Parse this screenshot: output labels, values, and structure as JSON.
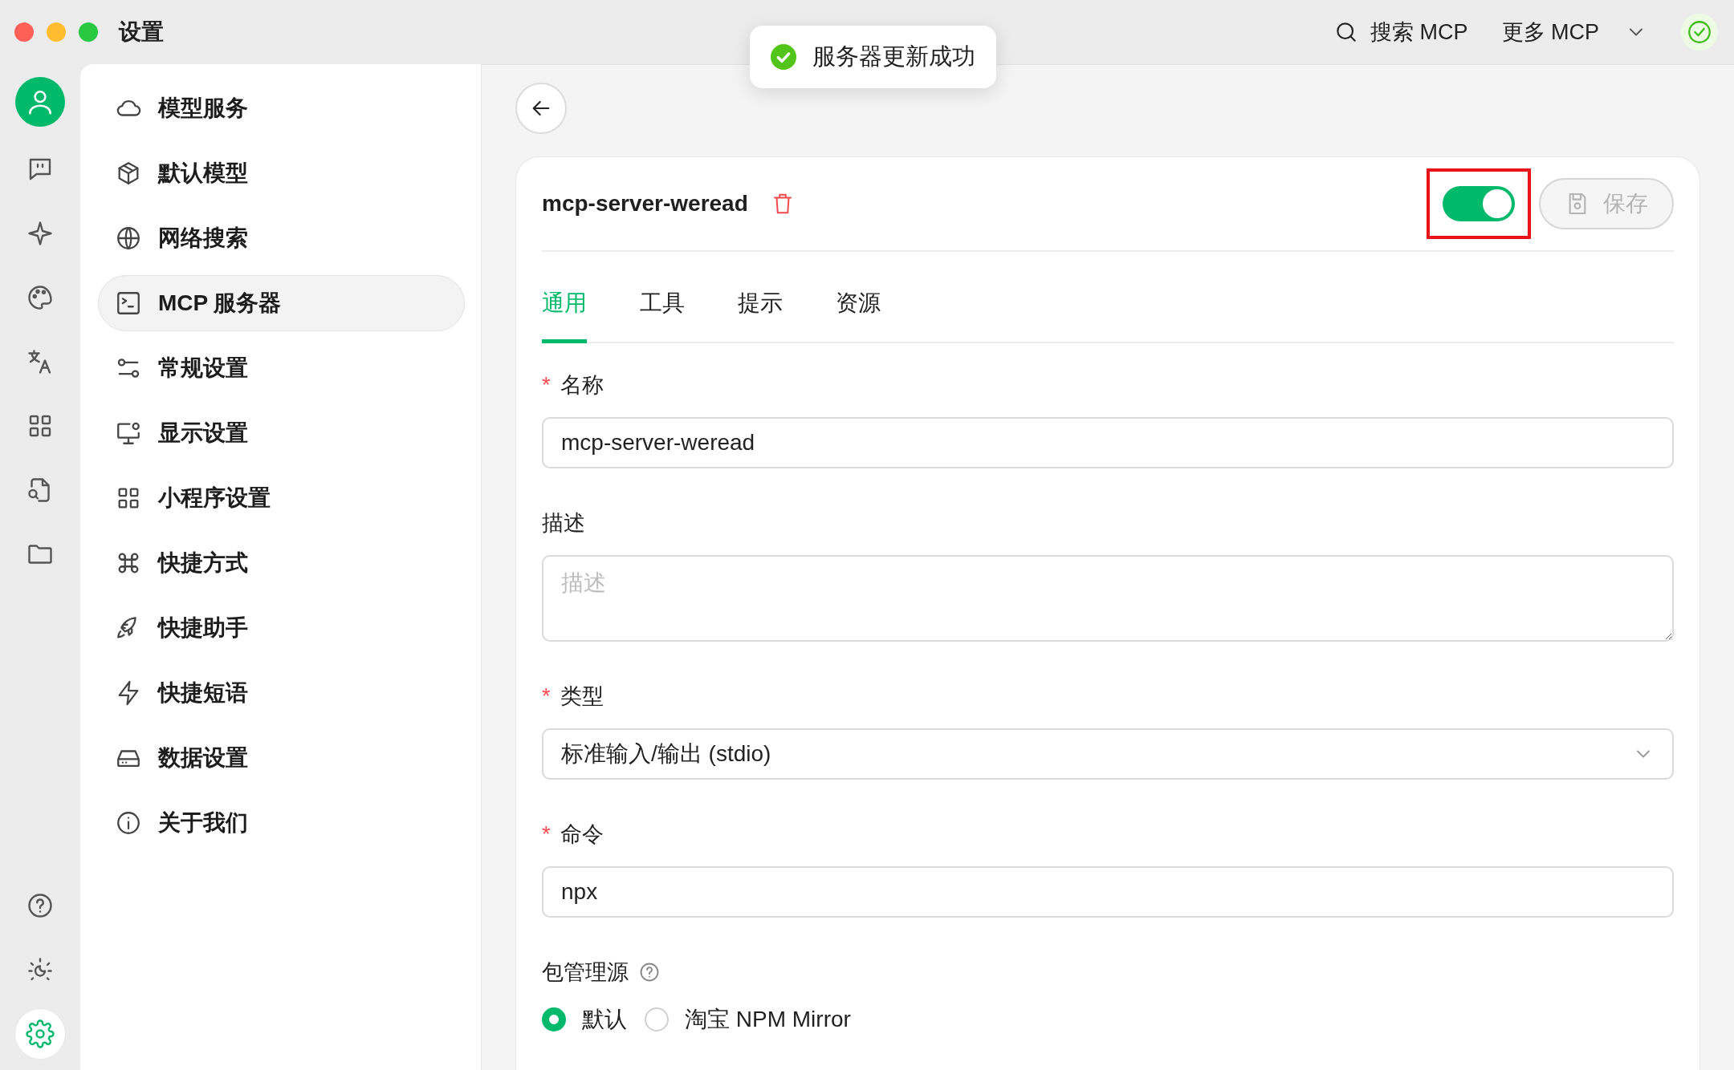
{
  "window": {
    "title": "设置"
  },
  "toast": {
    "text": "服务器更新成功"
  },
  "topbar": {
    "search_label": "搜索 MCP",
    "more_label": "更多 MCP",
    "status_ok": true
  },
  "rail": [
    {
      "selected": false
    },
    {
      "selected": false
    },
    {
      "selected": false
    },
    {
      "selected": false
    },
    {
      "selected": false
    },
    {
      "selected": false
    },
    {
      "selected": false
    },
    {
      "selected": false
    },
    {
      "selected": false
    },
    {
      "selected": false
    },
    {
      "selected": true
    }
  ],
  "sidebar": {
    "items": [
      {
        "label": "模型服务",
        "selected": false
      },
      {
        "label": "默认模型",
        "selected": false
      },
      {
        "label": "网络搜索",
        "selected": false
      },
      {
        "label": "MCP 服务器",
        "selected": true
      },
      {
        "label": "常规设置",
        "selected": false
      },
      {
        "label": "显示设置",
        "selected": false
      },
      {
        "label": "小程序设置",
        "selected": false
      },
      {
        "label": "快捷方式",
        "selected": false
      },
      {
        "label": "快捷助手",
        "selected": false
      },
      {
        "label": "快捷短语",
        "selected": false
      },
      {
        "label": "数据设置",
        "selected": false
      },
      {
        "label": "关于我们",
        "selected": false
      }
    ]
  },
  "server": {
    "name": "mcp-server-weread",
    "enabled": true,
    "save_label": "保存",
    "save_disabled": true,
    "tabs": [
      {
        "label": "通用",
        "selected": true
      },
      {
        "label": "工具",
        "selected": false
      },
      {
        "label": "提示",
        "selected": false
      },
      {
        "label": "资源",
        "selected": false
      }
    ],
    "fields": [
      {
        "kind": "input",
        "label": "名称",
        "required_mark": "*",
        "value": "mcp-server-weread"
      },
      {
        "kind": "textarea",
        "label": "描述",
        "placeholder": "描述"
      },
      {
        "kind": "select",
        "label": "类型",
        "required_mark": "*",
        "value": "标准输入/输出 (stdio)"
      },
      {
        "kind": "input",
        "label": "命令",
        "required_mark": "*",
        "value": "npx"
      },
      {
        "kind": "radio",
        "label": "包管理源",
        "help": true,
        "options": [
          {
            "label": "默认",
            "selected": true
          },
          {
            "label": "淘宝 NPM Mirror",
            "selected": false
          }
        ]
      }
    ]
  }
}
